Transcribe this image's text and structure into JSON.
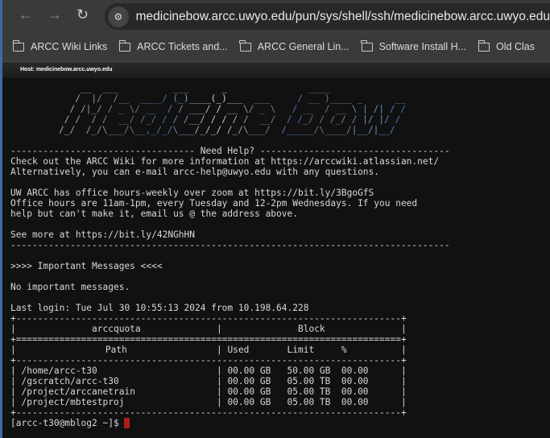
{
  "browser": {
    "url": "medicinebow.arcc.uwyo.edu/pun/sys/shell/ssh/medicinebow.arcc.uwyo.edu",
    "bookmarks": [
      "ARCC Wiki Links",
      "ARCC Tickets and...",
      "ARCC General Lin...",
      "Software Install H...",
      "Old Clas"
    ],
    "host_label": "Host: medicinebow.arcc.uwyo.edu"
  },
  "terminal": {
    "banner_art": [
      "    __  ___          ___      _               ____",
      "   /  |/  /__  ____/ (_)____(_)___  ___     / __ )____ _      __",
      "  / /|_/ / _ \\/ __  / / ___/ / __ \\/ _ \\   / __  / __ \\ | /| / /",
      " / /  / /  __/ /_/ / / /__/ / / / /  __/  / /_/ / /_/ / |/ |/ /",
      "/_/  /_/\\___/\\__,_/_/\\___/_/_/ /_/\\___/  /_____/\\____/|__/|__/"
    ],
    "motd": [
      "",
      "---------------------------------- Need Help? -----------------------------------",
      "Check out the ARCC Wiki for more information at https://arccwiki.atlassian.net/",
      "Alternatively, you can e-mail arcc-help@uwyo.edu with any questions.",
      "",
      "UW ARCC has office hours-weekly over zoom at https://bit.ly/3BgoGfS",
      "Office hours are 11am-1pm, every Tuesday and 12-2pm Wednesdays. If you need",
      "help but can't make it, email us @ the address above.",
      "",
      "See more at https://bit.ly/42NGhHN",
      "---------------------------------------------------------------------------------",
      "",
      ">>>> Important Messages <<<<",
      "",
      "No important messages.",
      "",
      "Last login: Tue Jul 30 10:55:13 2024 from 10.198.64.228"
    ],
    "quota": {
      "title": "arccquota",
      "group": "Block",
      "headers": {
        "path": "Path",
        "used": "Used",
        "limit": "Limit",
        "pct": "%"
      },
      "rows": [
        {
          "path": "/home/arcc-t30",
          "used": "00.00 GB",
          "limit": "50.00 GB",
          "pct": "00.00"
        },
        {
          "path": "/gscratch/arcc-t30",
          "used": "00.00 GB",
          "limit": "05.00 TB",
          "pct": "00.00"
        },
        {
          "path": "/project/arccanetrain",
          "used": "00.00 GB",
          "limit": "05.00 TB",
          "pct": "00.00"
        },
        {
          "path": "/project/mbtestproj",
          "used": "00.00 GB",
          "limit": "05.00 TB",
          "pct": "00.00"
        }
      ]
    },
    "prompt": "[arcc-t30@mblog2 ~]$ "
  },
  "colors": {
    "cursor": "#b31b1b",
    "terminal_bg": "#111111",
    "accent": "#3d6aa6"
  }
}
